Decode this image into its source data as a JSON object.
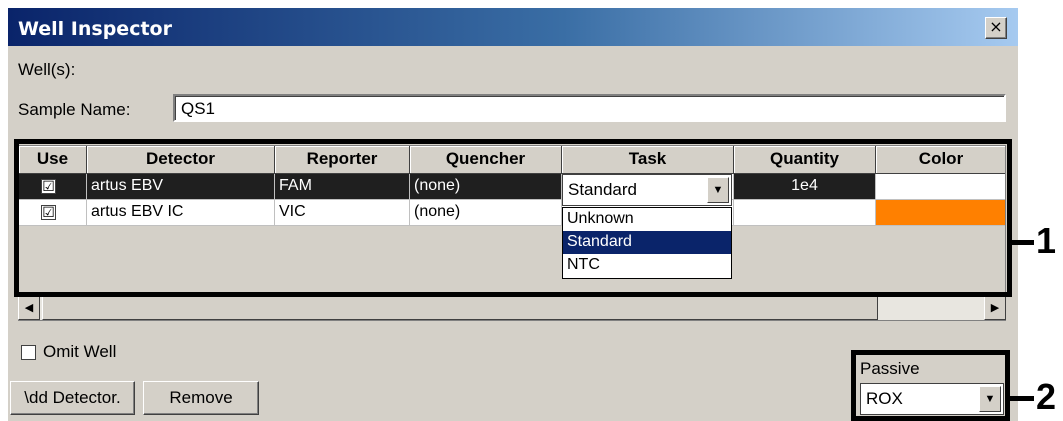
{
  "window": {
    "title": "Well Inspector",
    "close_glyph": "×"
  },
  "form": {
    "wells_label": "Well(s):",
    "sample_name_label": "Sample Name:",
    "sample_name_value": "QS1"
  },
  "table": {
    "columns": [
      "Use",
      "Detector",
      "Reporter",
      "Quencher",
      "Task",
      "Quantity",
      "Color"
    ],
    "rows": [
      {
        "use": "☑",
        "detector": "artus EBV",
        "reporter": "FAM",
        "quencher": "(none)",
        "task": "Standard",
        "quantity": "1e4",
        "color": "#ffffff"
      },
      {
        "use": "☑",
        "detector": "artus EBV IC",
        "reporter": "VIC",
        "quencher": "(none)",
        "task": "",
        "quantity": "",
        "color": "#ff8000"
      }
    ],
    "task_dropdown_options": [
      "Unknown",
      "Standard",
      "NTC"
    ],
    "task_selected": "Standard"
  },
  "omit_well": {
    "label": "Omit Well",
    "checked": false
  },
  "buttons": {
    "add_detector": "\\dd Detector.",
    "remove": "Remove"
  },
  "passive": {
    "label": "Passive",
    "value": "ROX"
  },
  "callouts": [
    "1",
    "2"
  ]
}
